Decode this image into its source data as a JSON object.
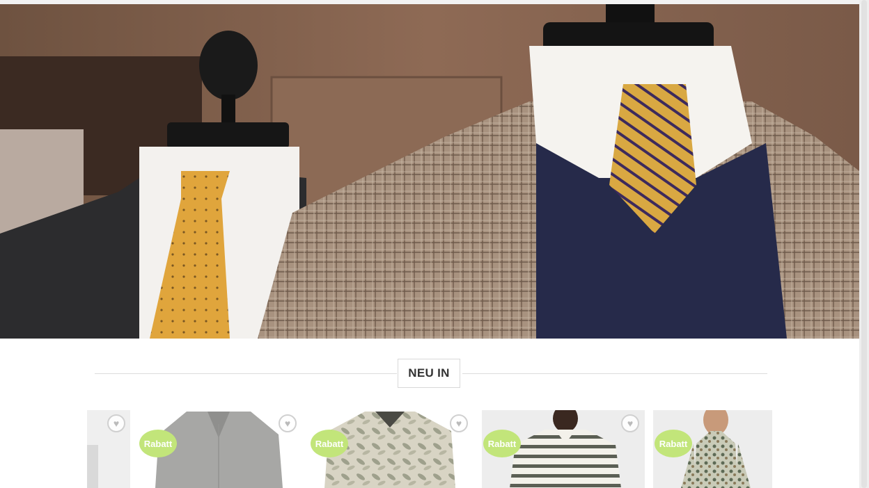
{
  "section": {
    "title": "NEU IN"
  },
  "products": [
    {
      "name": "partial-product",
      "badge": ""
    },
    {
      "name": "grey-polo",
      "badge": "Rabatt"
    },
    {
      "name": "floral-polo",
      "badge": "Rabatt"
    },
    {
      "name": "striped-polo",
      "badge": "Rabatt"
    },
    {
      "name": "paisley-shirt",
      "badge": "Rabatt"
    }
  ],
  "icons": {
    "wishlist": "heart-icon"
  },
  "colors": {
    "badge": "#c2e57a",
    "background": "#ffffff",
    "rule": "#dcdcdc"
  }
}
